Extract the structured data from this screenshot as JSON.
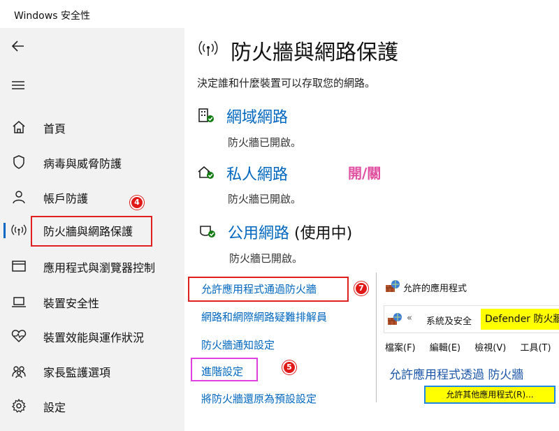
{
  "window": {
    "title": "Windows 安全性"
  },
  "sidebar": {
    "items": [
      {
        "label": "首頁",
        "icon": "home-icon"
      },
      {
        "label": "病毒與威脅防護",
        "icon": "shield-icon"
      },
      {
        "label": "帳戶防護",
        "icon": "person-icon"
      },
      {
        "label": "防火牆與網路保護",
        "icon": "wifi-signal-icon",
        "active": true
      },
      {
        "label": "應用程式與瀏覽器控制",
        "icon": "window-icon"
      },
      {
        "label": "裝置安全性",
        "icon": "laptop-icon"
      },
      {
        "label": "裝置效能與運作狀況",
        "icon": "heart-pulse-icon"
      },
      {
        "label": "家長監護選項",
        "icon": "family-icon"
      },
      {
        "label": "設定",
        "icon": "gear-icon"
      }
    ]
  },
  "main": {
    "title": "防火牆與網路保護",
    "subtitle": "決定誰和什麼裝置可以存取您的網路。",
    "networks": [
      {
        "name": "網域網路",
        "suffix": "",
        "status": "防火牆已開啟。",
        "icon": "domain-network-icon"
      },
      {
        "name": "私人網路",
        "suffix": "",
        "status": "防火牆已開啟。",
        "icon": "private-network-icon"
      },
      {
        "name": "公用網路",
        "suffix": " (使用中)",
        "status": "防火牆已開啟。",
        "icon": "public-network-icon"
      }
    ],
    "annotation": "開/關",
    "links": [
      "允許應用程式通過防火牆",
      "網路和網際網路疑難排解員",
      "防火牆通知設定",
      "進階設定",
      "將防火牆還原為預設設定"
    ]
  },
  "badges": {
    "sidebar": "4",
    "advanced": "5",
    "allow_app": "7"
  },
  "popup": {
    "title": "允許的應用程式",
    "breadcrumb_prefix": "«",
    "breadcrumb_home": "系統及安全",
    "breadcrumb_current": "Defender 防火牆",
    "menu": [
      "檔案(F)",
      "編輯(E)",
      "檢視(V)",
      "工具(T)"
    ],
    "heading": "允許應用程式透過 防火牆",
    "button": "允許其他應用程式(R)..."
  },
  "colors": {
    "accent": "#0067c0",
    "highlight": "#ffff00",
    "red_box": "#e02020",
    "pink_box": "#e040e0"
  }
}
